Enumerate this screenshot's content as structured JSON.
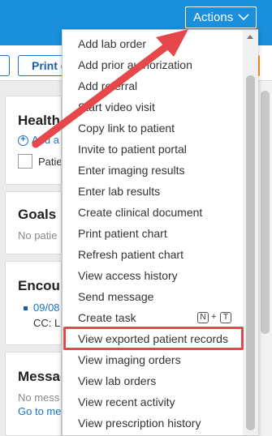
{
  "header": {
    "actions_label": "Actions",
    "accent": "#1a8fdc"
  },
  "toolbar": {
    "print_label": "Print c"
  },
  "cards": {
    "health": {
      "title": "Health",
      "add_link": "Add a",
      "checkbox_label": "Patie"
    },
    "goals": {
      "title": "Goals",
      "empty": "No patie"
    },
    "encounters": {
      "title": "Encou",
      "date_link": "09/08",
      "cc": "CC: L"
    },
    "messages": {
      "title": "Messag",
      "empty": "No mess",
      "goto": "Go to me"
    }
  },
  "menu": {
    "items": [
      "Add lab order",
      "Add prior authorization",
      "Add referral",
      "Start video visit",
      "Copy link to patient",
      "Invite to patient portal",
      "Enter imaging results",
      "Enter lab results",
      "Create clinical document",
      "Print patient chart",
      "Refresh patient chart",
      "View access history",
      "Send message",
      "Create task",
      "View exported patient records",
      "View imaging orders",
      "View lab orders",
      "View recent activity",
      "View prescription history"
    ],
    "create_task_shortcut": {
      "key1": "N",
      "plus": "+",
      "key2": "T"
    },
    "highlighted_item": "View exported patient records",
    "highlight_color": "#e5474b"
  },
  "icons": {
    "chevron": "chevron-down-icon",
    "plus": "plus-circle-icon",
    "arrow": "annotation-arrow"
  }
}
